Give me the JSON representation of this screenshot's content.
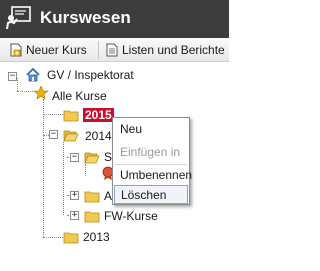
{
  "header": {
    "title": "Kurswesen",
    "icon": "presentation-board-icon"
  },
  "toolbar": {
    "new_course_label": "Neuer Kurs",
    "lists_reports_label": "Listen und Berichte"
  },
  "tree": {
    "root_label": "GV / Inspektorat",
    "all_courses_label": "Alle Kurse",
    "year_2015_label": "2015",
    "year_2014_label": "2014",
    "child_s_label": "S",
    "child_a_label": "A",
    "fw_courses_label": "FW-Kurse",
    "year_2013_label": "2013"
  },
  "context_menu": {
    "items": [
      "Neu",
      "Einfügen in",
      "Umbenennen",
      "Löschen"
    ]
  },
  "colors": {
    "header_bg": "#3d3d3d",
    "selection": "#c8102e"
  }
}
